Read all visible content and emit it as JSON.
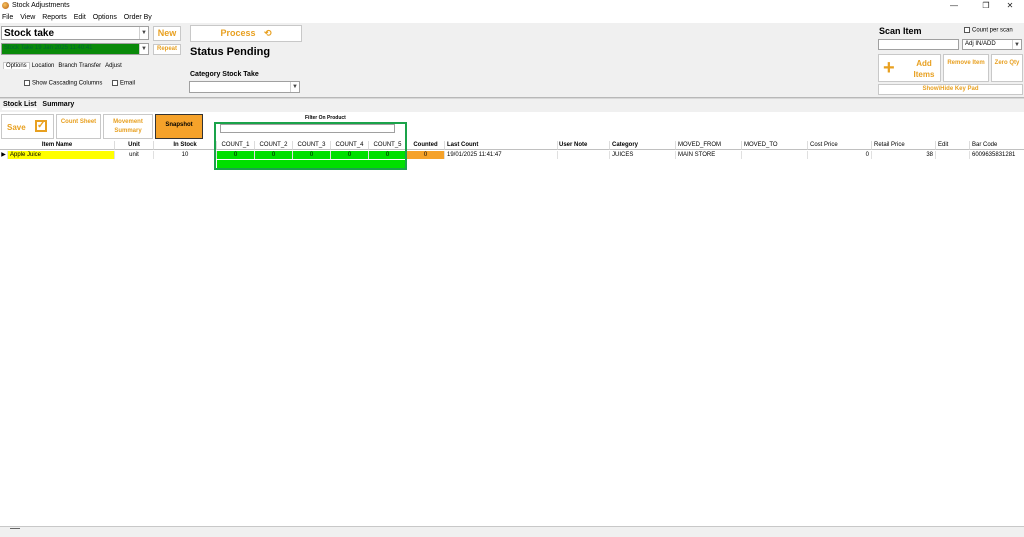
{
  "window": {
    "title": "Stock Adjustments",
    "minimize": "—",
    "restore": "❐",
    "close": "✕"
  },
  "menu": [
    "File",
    "View",
    "Reports",
    "Edit",
    "Options",
    "Order By"
  ],
  "stock_take": {
    "type_value": "Stock take",
    "session_value": "Stock Take 19 Jan 2025 11:40:41",
    "new_label": "New",
    "repeat_label": "Repeat",
    "process_label": "Process",
    "status": "Status Pending",
    "category_label": "Category Stock Take",
    "category_value": ""
  },
  "option_tabs": [
    "Options",
    "Location",
    "Branch Transfer",
    "Adjust"
  ],
  "checks": {
    "cascading": "Show Cascading Columns",
    "email": "Email"
  },
  "scan": {
    "label": "Scan Item",
    "count_per_scan": "Count per scan",
    "mode_value": "Adj IN/ADD",
    "add_items": "Add Items",
    "remove_item": "Remove Item",
    "zero_qty": "Zero Qty",
    "keypad": "Show\\Hide Key Pad"
  },
  "list_tabs": [
    "Stock List",
    "Summary"
  ],
  "toolbar": {
    "save": "Save",
    "count_sheet": "Count Sheet",
    "movement_summary": "Movement Summary",
    "snapshot": "Snapshot"
  },
  "filter_label": "Filter On Product",
  "columns": [
    "Item Name",
    "Unit",
    "In Stock",
    "COUNT_1",
    "COUNT_2",
    "COUNT_3",
    "COUNT_4",
    "COUNT_5",
    "Counted",
    "Last Count",
    "User Note",
    "Category",
    "MOVED_FROM",
    "MOVED_TO",
    "Cost Price",
    "Retail Price",
    "Edit",
    "Bar Code"
  ],
  "rows": [
    {
      "item_name": "Apple Juice",
      "unit": "unit",
      "in_stock": "10",
      "count_1": "0",
      "count_2": "0",
      "count_3": "0",
      "count_4": "0",
      "count_5": "0",
      "counted": "0",
      "last_count": "19/01/2025 11:41:47",
      "user_note": "",
      "category": "JUICES",
      "moved_from": "MAIN STORE",
      "moved_to": "",
      "cost_price": "0",
      "retail_price": "38",
      "edit": "",
      "bar_code": "6009635831281"
    }
  ],
  "colors": {
    "accent": "#e8a020",
    "count_green": "#00e000",
    "highlight_box": "#1aa34a",
    "row_yellow": "#ffff00",
    "counted_orange": "#f5a22a"
  }
}
